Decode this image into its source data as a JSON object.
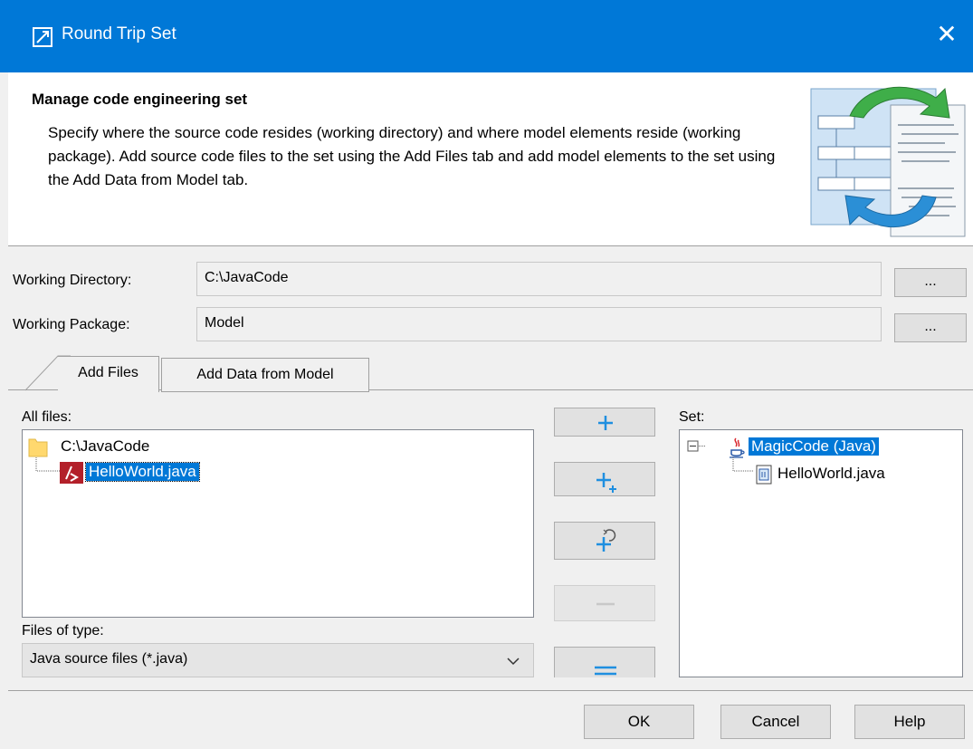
{
  "window": {
    "title": "Round Trip Set",
    "close_glyph": "✕",
    "app_icon": "diagram-arrow-icon",
    "accent_color": "#0078d7"
  },
  "header": {
    "title": "Manage code engineering set",
    "description": "Specify where the source code resides (working directory) and where model elements reside (working package). Add source code files to the set using the Add Files tab and add model elements to the set using the Add Data from Model tab.",
    "illustration": "round-trip-engineering-illustration"
  },
  "fields": {
    "working_directory": {
      "label": "Working Directory:",
      "value": "C:\\JavaCode",
      "browse_label": "..."
    },
    "working_package": {
      "label": "Working Package:",
      "value": "Model",
      "browse_label": "..."
    }
  },
  "tabs": [
    {
      "label": "Add Files",
      "active": true
    },
    {
      "label": "Add Data from Model",
      "active": false
    }
  ],
  "all_files": {
    "label": "All files:",
    "root": {
      "label": "C:\\JavaCode",
      "icon": "folder-icon"
    },
    "children": [
      {
        "label": "HelloWorld.java",
        "icon": "java-file-icon",
        "selected": true
      }
    ]
  },
  "files_of_type": {
    "label": "Files of type:",
    "selected": "Java source files (*.java)"
  },
  "side_buttons": [
    {
      "name": "add",
      "icon": "plus-icon",
      "enabled": true
    },
    {
      "name": "add-all",
      "icon": "plus-recursive-icon",
      "enabled": true
    },
    {
      "name": "add-refresh",
      "icon": "plus-refresh-icon",
      "enabled": true
    },
    {
      "name": "remove",
      "icon": "minus-icon",
      "enabled": false
    },
    {
      "name": "remove-all",
      "icon": "double-minus-icon",
      "enabled": true
    }
  ],
  "set": {
    "label": "Set:",
    "root": {
      "label": "MagicCode (Java)",
      "icon": "java-coffee-icon",
      "selected": true,
      "expanded": true
    },
    "children": [
      {
        "label": "HelloWorld.java",
        "icon": "java-class-file-icon"
      }
    ]
  },
  "buttons": {
    "ok": "OK",
    "cancel": "Cancel",
    "help": "Help"
  }
}
